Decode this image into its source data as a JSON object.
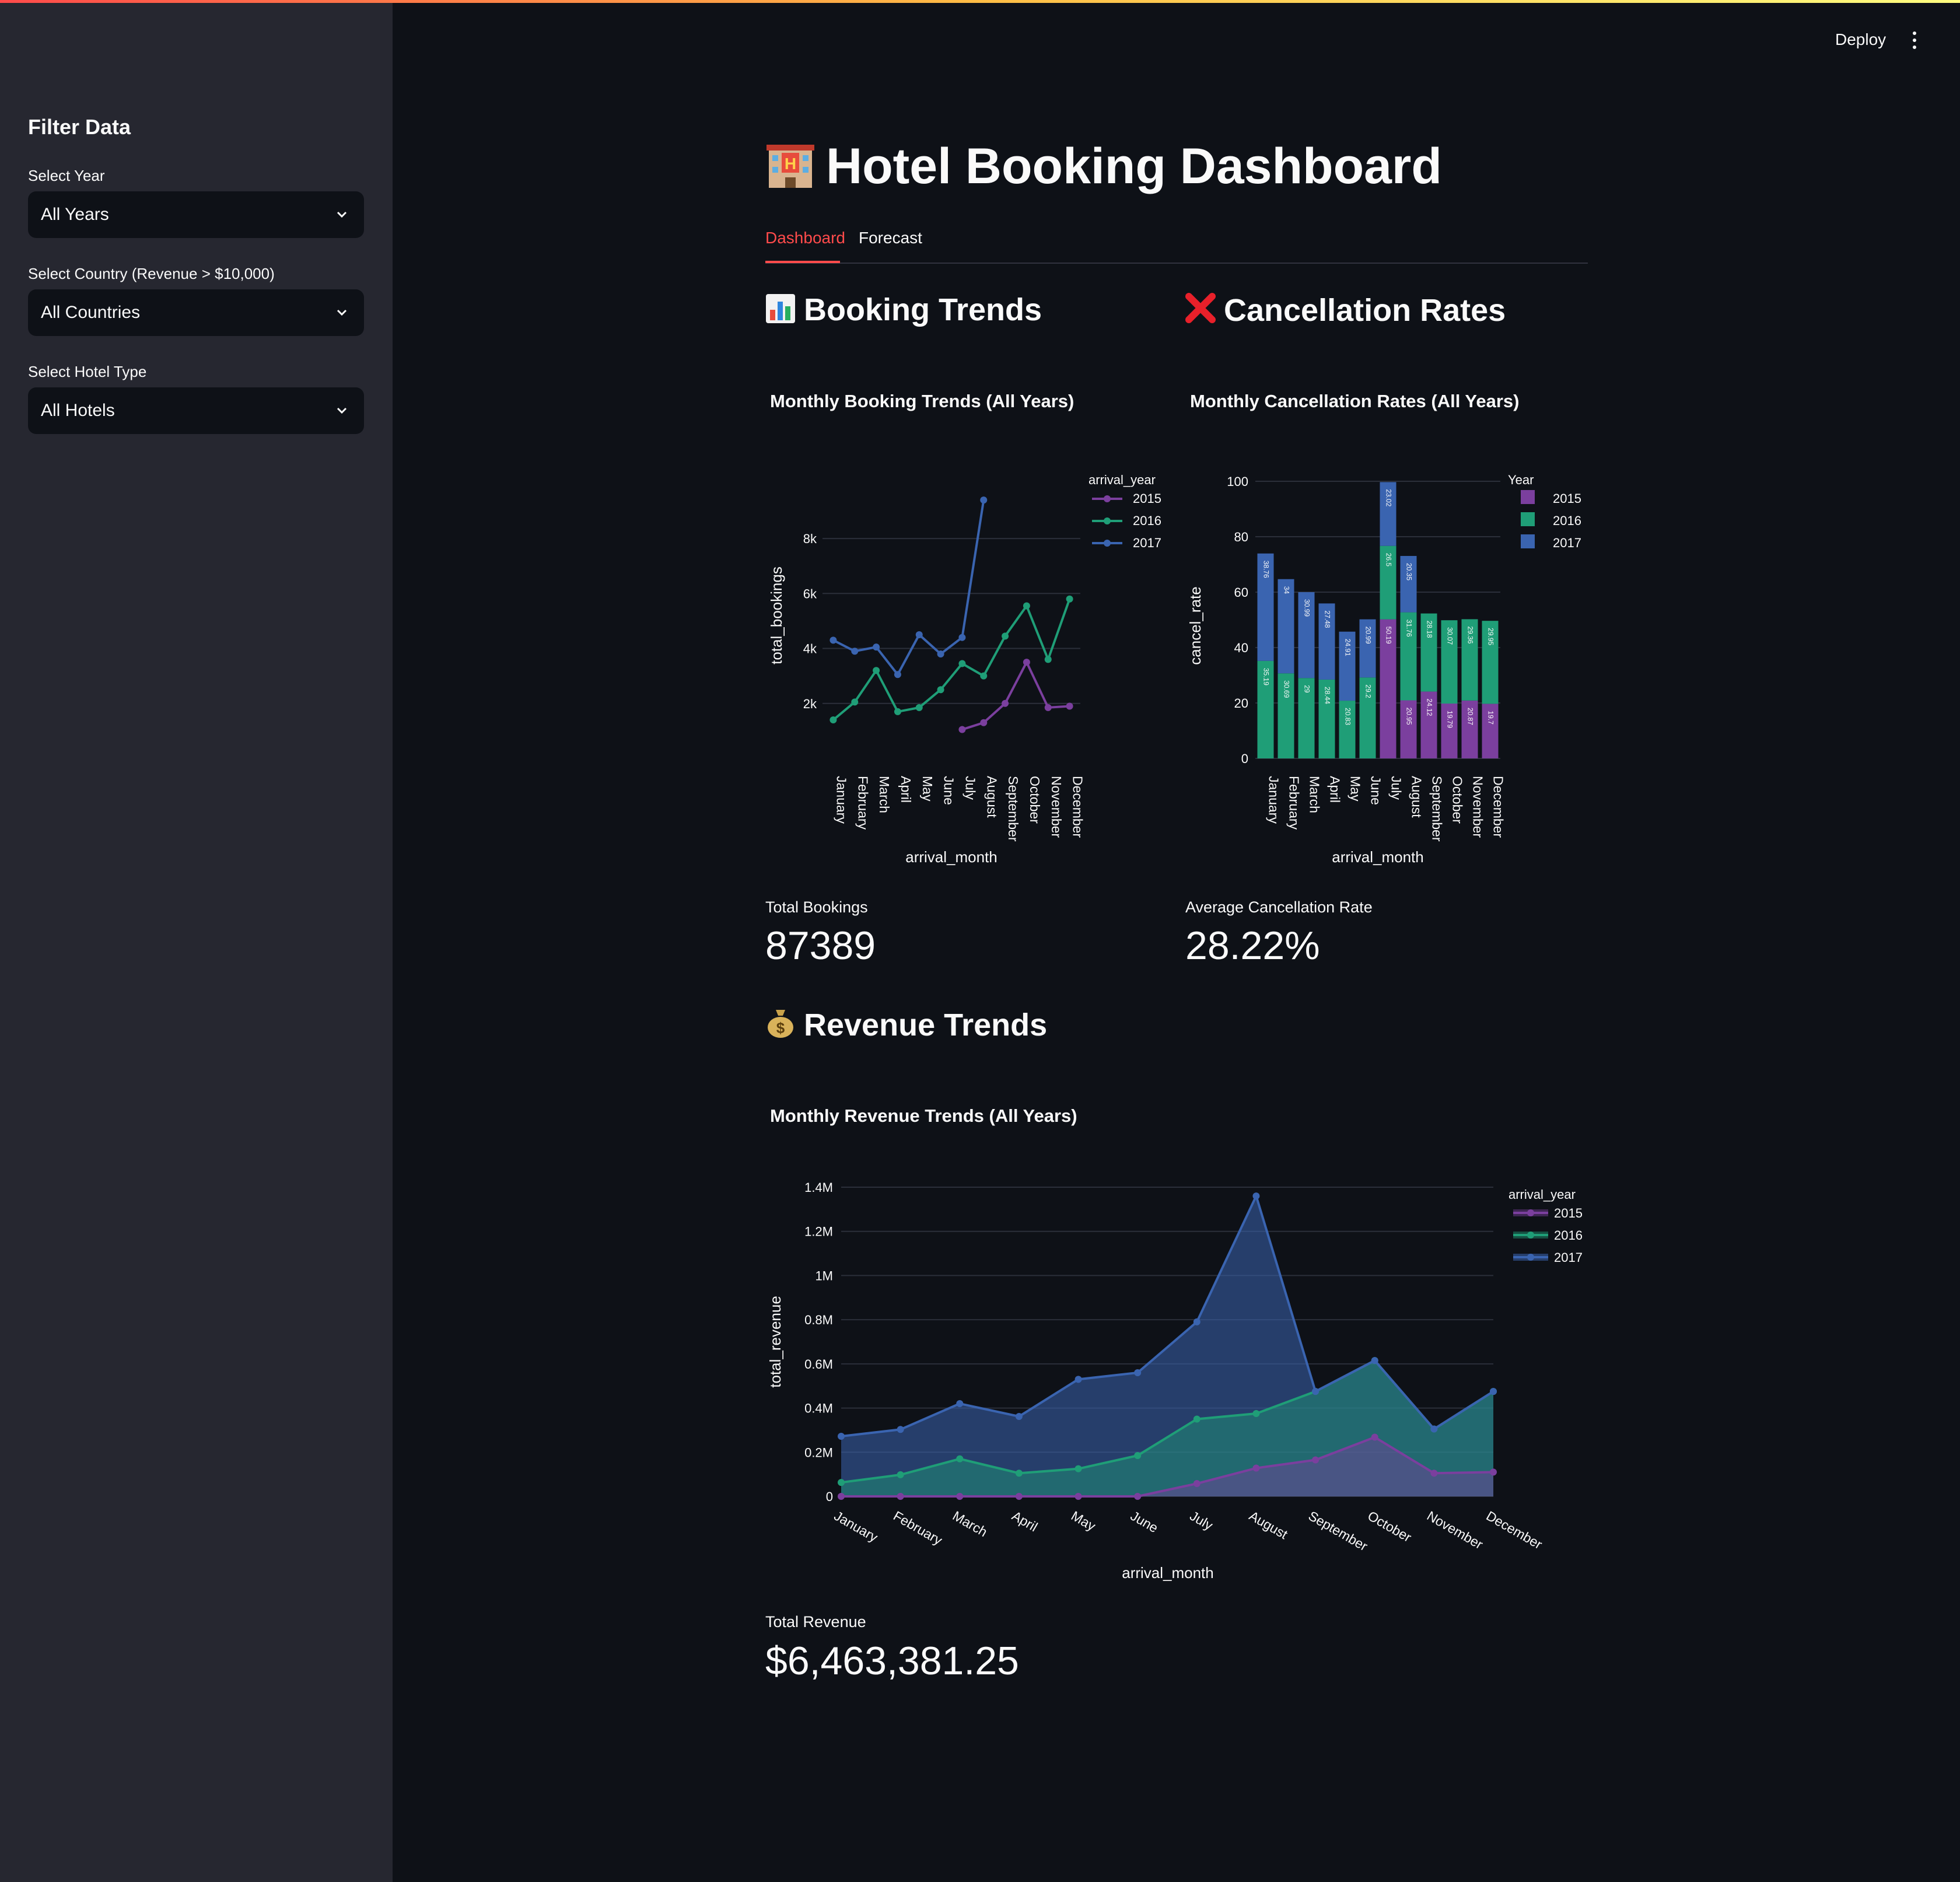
{
  "sidebar": {
    "title": "Filter Data",
    "year": {
      "label": "Select Year",
      "value": "All Years"
    },
    "country": {
      "label": "Select Country (Revenue > $10,000)",
      "value": "All Countries"
    },
    "hotel": {
      "label": "Select Hotel Type",
      "value": "All Hotels"
    }
  },
  "header": {
    "deploy_label": "Deploy"
  },
  "main": {
    "title": "Hotel Booking Dashboard",
    "tabs": [
      "Dashboard",
      "Forecast"
    ],
    "sections": {
      "booking": "Booking Trends",
      "cancel": "Cancellation Rates",
      "revenue": "Revenue Trends"
    }
  },
  "metrics": {
    "bookings": {
      "label": "Total Bookings",
      "value": "87389"
    },
    "cancel": {
      "label": "Average Cancellation Rate",
      "value": "28.22%"
    },
    "revenue": {
      "label": "Total Revenue",
      "value": "$6,463,381.25"
    }
  },
  "colors": {
    "2015": "#7b3f9e",
    "2016": "#1f9e77",
    "2017": "#3a64b0"
  },
  "chart_data": [
    {
      "type": "line",
      "title": "Monthly Booking Trends (All Years)",
      "xlabel": "arrival_month",
      "ylabel": "total_bookings",
      "legend_title": "arrival_year",
      "categories": [
        "January",
        "February",
        "March",
        "April",
        "May",
        "June",
        "July",
        "August",
        "September",
        "October",
        "November",
        "December"
      ],
      "y_ticks": [
        "2k",
        "4k",
        "6k",
        "8k"
      ],
      "series": [
        {
          "name": "2015",
          "values": [
            null,
            null,
            null,
            null,
            null,
            null,
            1050,
            1300,
            2000,
            3500,
            1850,
            1900
          ]
        },
        {
          "name": "2016",
          "values": [
            1400,
            2050,
            3200,
            1700,
            1850,
            2500,
            3450,
            3000,
            4450,
            5550,
            3600,
            5800
          ]
        },
        {
          "name": "2017",
          "values": [
            4300,
            3900,
            4050,
            3050,
            4500,
            3800,
            4400,
            9400,
            null,
            null,
            null,
            null
          ]
        }
      ]
    },
    {
      "type": "bar",
      "title": "Monthly Cancellation Rates (All Years)",
      "xlabel": "arrival_month",
      "ylabel": "cancel_rate",
      "legend_title": "Year",
      "categories": [
        "January",
        "February",
        "March",
        "April",
        "May",
        "June",
        "July",
        "August",
        "September",
        "October",
        "November",
        "December"
      ],
      "y_ticks": [
        "0",
        "20",
        "40",
        "60",
        "80",
        "100"
      ],
      "series": [
        {
          "name": "2015",
          "values": [
            null,
            null,
            null,
            null,
            null,
            null,
            50.19,
            20.95,
            24.12,
            19.79,
            20.87,
            19.7
          ],
          "labels": [
            "",
            "",
            "",
            "",
            "",
            "",
            "50.19",
            "20.95",
            "24.12",
            "19.79",
            "20.87",
            "19.7"
          ]
        },
        {
          "name": "2016",
          "values": [
            35.19,
            30.69,
            29,
            28.44,
            20.83,
            29.2,
            26.5,
            31.76,
            28.18,
            30.07,
            29.36,
            29.95
          ],
          "labels": [
            "35.19",
            "30.69",
            "29",
            "28.44",
            "20.83",
            "29.2",
            "26.5",
            "31.76",
            "28.18",
            "30.07",
            "29.36",
            "29.95"
          ]
        },
        {
          "name": "2017",
          "values": [
            38.76,
            34,
            30.99,
            27.48,
            24.91,
            20.99,
            23.02,
            20.35,
            null,
            null,
            null,
            null
          ],
          "labels": [
            "38.76",
            "34",
            "30.99",
            "27.48",
            "24.91",
            "20.99",
            "23.02",
            "20.35",
            "",
            "",
            "",
            ""
          ]
        }
      ]
    },
    {
      "type": "area",
      "title": "Monthly Revenue Trends (All Years)",
      "xlabel": "arrival_month",
      "ylabel": "total_revenue",
      "legend_title": "arrival_year",
      "categories": [
        "January",
        "February",
        "March",
        "April",
        "May",
        "June",
        "July",
        "August",
        "September",
        "October",
        "November",
        "December"
      ],
      "y_ticks": [
        "0",
        "0.2M",
        "0.4M",
        "0.6M",
        "0.8M",
        "1M",
        "1.2M",
        "1.4M"
      ],
      "series": [
        {
          "name": "2015",
          "values": [
            0,
            0,
            0,
            0,
            0,
            0,
            58000,
            128000,
            165000,
            268000,
            105000,
            110000
          ]
        },
        {
          "name": "2016",
          "values": [
            63000,
            98000,
            170000,
            105000,
            125000,
            185000,
            350000,
            375000,
            475000,
            615000,
            305000,
            475000
          ]
        },
        {
          "name": "2017",
          "values": [
            272000,
            303000,
            420000,
            362000,
            530000,
            560000,
            790000,
            1360000,
            475000,
            615000,
            305000,
            475000
          ]
        }
      ]
    }
  ]
}
